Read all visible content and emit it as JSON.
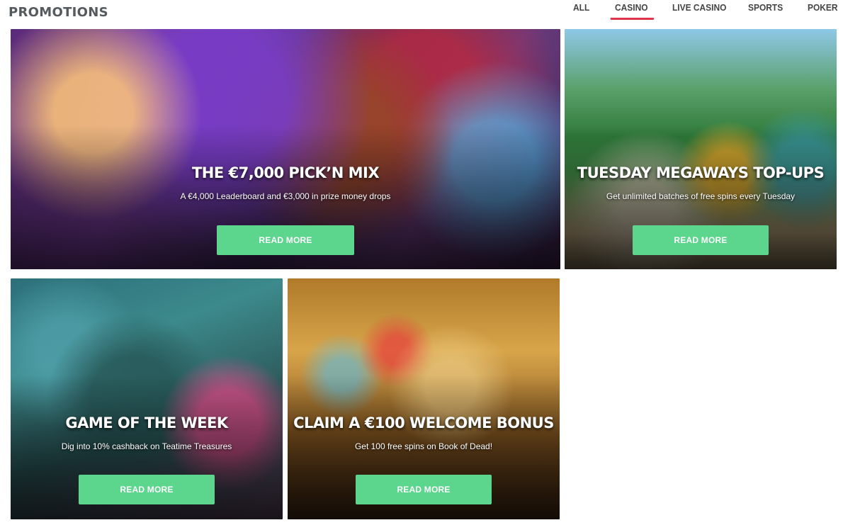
{
  "header": {
    "title": "PROMOTIONS",
    "tabs": [
      {
        "label": "ALL"
      },
      {
        "label": "CASINO"
      },
      {
        "label": "LIVE CASINO"
      },
      {
        "label": "SPORTS"
      },
      {
        "label": "POKER"
      }
    ],
    "active_tab": "CASINO",
    "active_color": "#e0344a"
  },
  "promotions": [
    {
      "title": "THE €7,000 PICK’N MIX",
      "subtitle": "A €4,000 Leaderboard and €3,000 in prize money drops",
      "button_label": "READ MORE"
    },
    {
      "title": "TUESDAY MEGAWAYS TOP-UPS",
      "subtitle": "Get unlimited batches of free spins every Tuesday",
      "button_label": "READ MORE"
    },
    {
      "title": "GAME OF THE WEEK",
      "subtitle": "Dig into 10% cashback on Teatime Treasures",
      "button_label": "READ MORE"
    },
    {
      "title": "CLAIM A €100 WELCOME BONUS",
      "subtitle": "Get 100 free spins on Book of Dead!",
      "button_label": "READ MORE"
    }
  ],
  "colors": {
    "button": "#5cd68d",
    "title_text": "#555a5e"
  }
}
